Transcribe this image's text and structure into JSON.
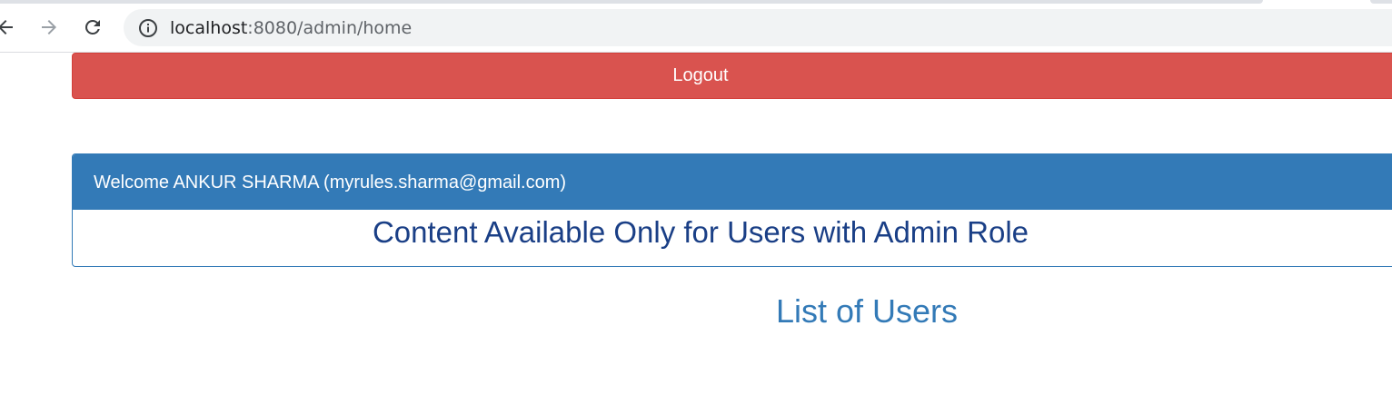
{
  "browser": {
    "url_host": "localhost",
    "url_rest": ":8080/admin/home",
    "back_icon": "back-arrow-icon",
    "forward_icon": "forward-arrow-icon",
    "reload_icon": "reload-icon",
    "site_info_icon": "info-icon"
  },
  "page": {
    "logout_label": "Logout",
    "welcome_text": "Welcome ANKUR SHARMA (myrules.sharma@gmail.com)",
    "admin_content": "Content Available Only for Users with Admin Role",
    "users_heading": "List of Users"
  },
  "colors": {
    "danger": "#d9534f",
    "primary": "#337ab7",
    "panel_body_text": "#1a3f86"
  }
}
